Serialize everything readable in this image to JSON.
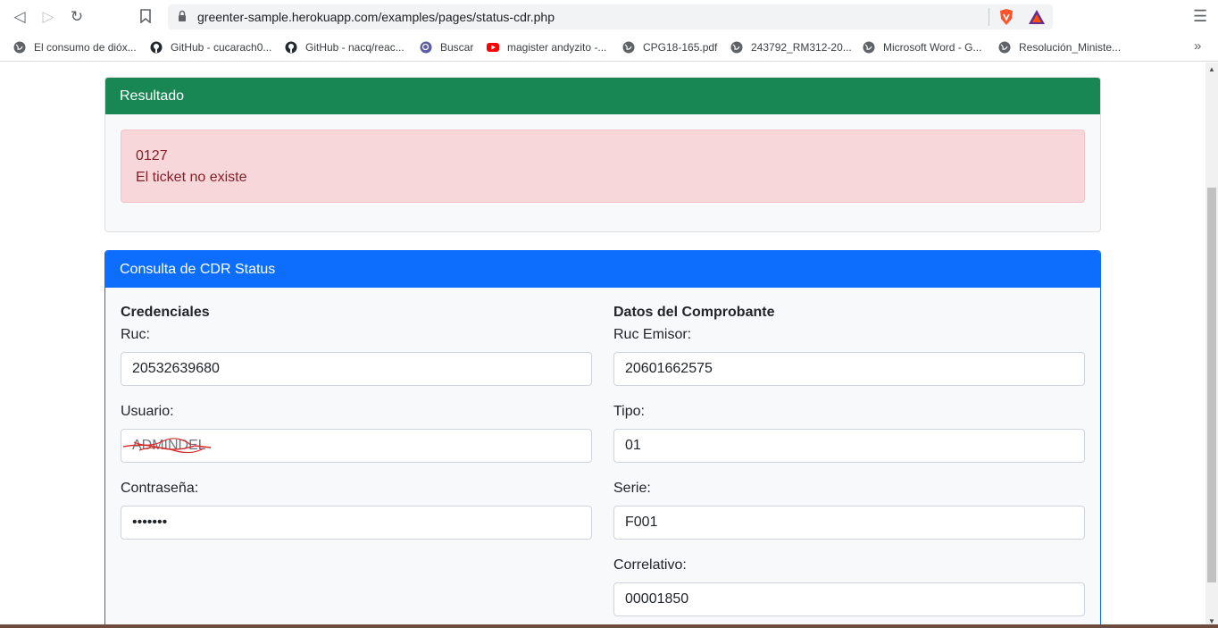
{
  "browser": {
    "url": "greenter-sample.herokuapp.com/examples/pages/status-cdr.php",
    "bookmarks": [
      {
        "label": "El consumo de dióx...",
        "icon": "globe-icon"
      },
      {
        "label": "GitHub - cucarach0...",
        "icon": "github-icon"
      },
      {
        "label": "GitHub - nacq/reac...",
        "icon": "github-icon"
      },
      {
        "label": "Buscar",
        "icon": "search-site-icon"
      },
      {
        "label": "magister andyzito -...",
        "icon": "youtube-icon"
      },
      {
        "label": "CPG18-165.pdf",
        "icon": "globe-icon"
      },
      {
        "label": "243792_RM312-20...",
        "icon": "globe-icon"
      },
      {
        "label": "Microsoft Word - G...",
        "icon": "globe-icon"
      },
      {
        "label": "Resolución_Ministe...",
        "icon": "globe-icon"
      }
    ],
    "colors": {
      "brave": "#fb542b",
      "youtube": "#ff0000"
    }
  },
  "result": {
    "title": "Resultado",
    "code": "0127",
    "message": "El ticket no existe",
    "header_color": "#198754"
  },
  "form": {
    "title": "Consulta de CDR Status",
    "header_color": "#0d6efd",
    "credentials": {
      "title": "Credenciales",
      "ruc_label": "Ruc:",
      "ruc_value": "20532639680",
      "user_label": "Usuario:",
      "user_value": "ADMINDEL",
      "password_label": "Contraseña:",
      "password_value": "•••••••"
    },
    "voucher": {
      "title": "Datos del Comprobante",
      "ruc_emisor_label": "Ruc Emisor:",
      "ruc_emisor_value": "20601662575",
      "tipo_label": "Tipo:",
      "tipo_value": "01",
      "serie_label": "Serie:",
      "serie_value": "F001",
      "correlativo_label": "Correlativo:",
      "correlativo_value": "00001850"
    }
  }
}
